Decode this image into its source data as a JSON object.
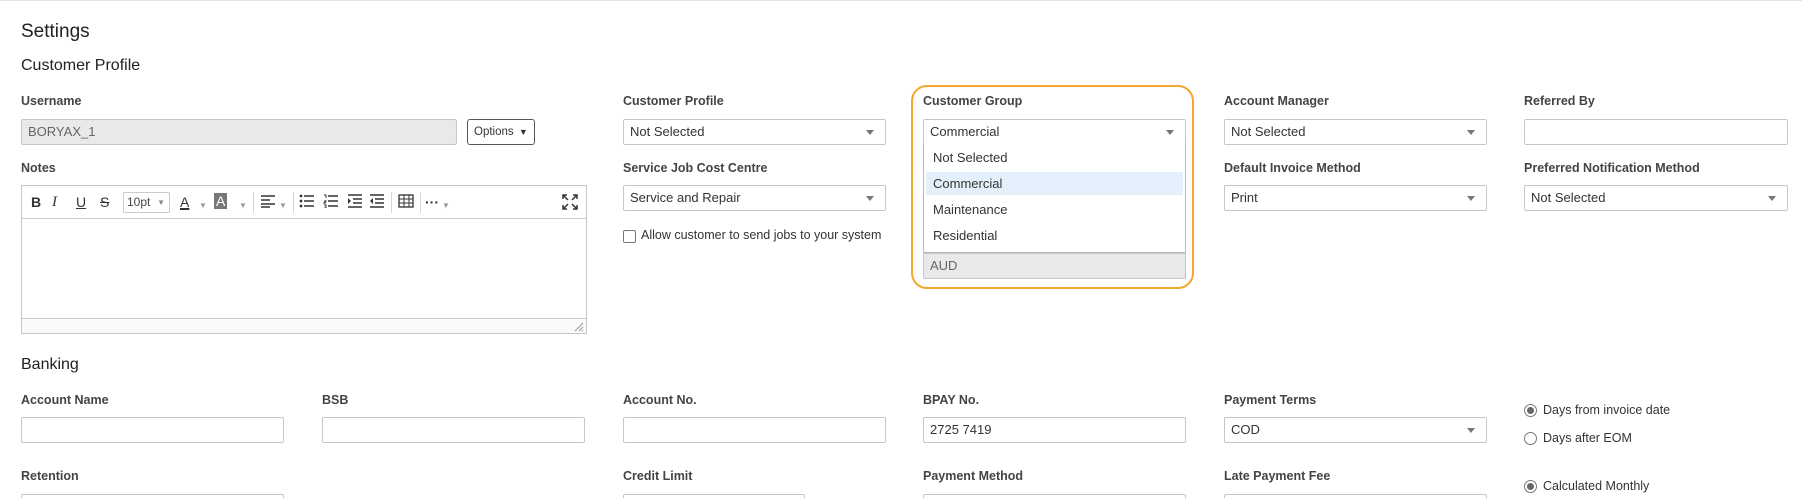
{
  "page": {
    "title": "Settings"
  },
  "customer_profile": {
    "section_title": "Customer Profile",
    "username": {
      "label": "Username",
      "value": "BORYAX_1"
    },
    "options_button": "Options",
    "customer_profile_field": {
      "label": "Customer Profile",
      "value": "Not Selected"
    },
    "customer_group": {
      "label": "Customer Group",
      "value": "Commercial",
      "options": [
        "Not Selected",
        "Commercial",
        "Maintenance",
        "Residential"
      ],
      "selected_option": "Commercial"
    },
    "currency_value": "AUD",
    "account_manager": {
      "label": "Account Manager",
      "value": "Not Selected"
    },
    "referred_by": {
      "label": "Referred By",
      "value": ""
    },
    "notes": {
      "label": "Notes",
      "font_size": "10pt",
      "value": ""
    },
    "service_job_cost_centre": {
      "label": "Service Job Cost Centre",
      "value": "Service and Repair"
    },
    "allow_jobs_checkbox": {
      "label": "Allow customer to send jobs to your system",
      "checked": false
    },
    "default_invoice_method": {
      "label": "Default Invoice Method",
      "value": "Print"
    },
    "preferred_notification_method": {
      "label": "Preferred Notification Method",
      "value": "Not Selected"
    }
  },
  "banking": {
    "section_title": "Banking",
    "account_name": {
      "label": "Account Name",
      "value": ""
    },
    "bsb": {
      "label": "BSB",
      "value": ""
    },
    "account_no": {
      "label": "Account No.",
      "value": ""
    },
    "bpay_no": {
      "label": "BPAY No.",
      "value": "2725 7419"
    },
    "payment_terms": {
      "label": "Payment Terms",
      "value": "COD"
    },
    "terms_radio": [
      {
        "label": "Days from invoice date",
        "checked": true
      },
      {
        "label": "Days after EOM",
        "checked": false
      }
    ],
    "retention": {
      "label": "Retention"
    },
    "credit_limit": {
      "label": "Credit Limit"
    },
    "payment_method": {
      "label": "Payment Method"
    },
    "late_payment_fee": {
      "label": "Late Payment Fee"
    },
    "calculated_radio": {
      "label": "Calculated Monthly",
      "checked": true
    }
  },
  "colors": {
    "highlight": "#f2a72e",
    "active_option": "#e3f0fc",
    "readonly_bg": "#e9e9e9"
  }
}
